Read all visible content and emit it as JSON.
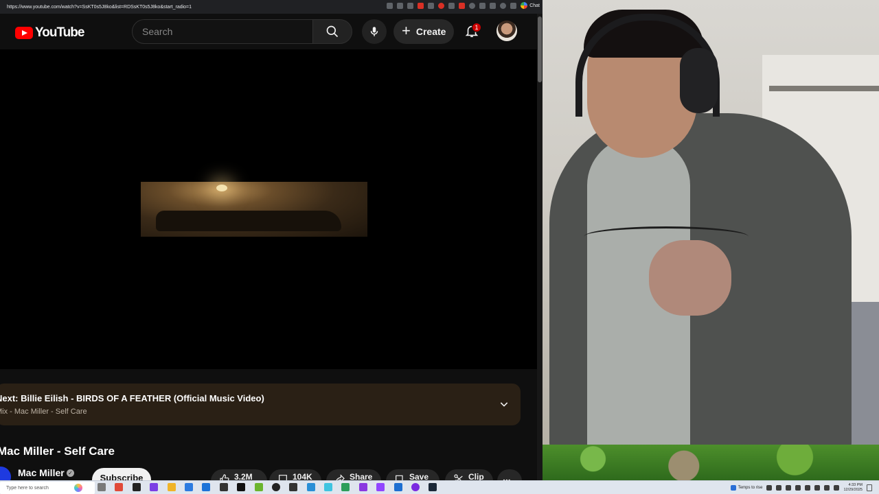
{
  "browser": {
    "url": "https://www.youtube.com/watch?v=SsKT0s5J8ko&list=RDSsKT0s5J8ko&start_radio=1",
    "chat_extension_label": "Chat"
  },
  "header": {
    "logo_text": "YouTube",
    "search_placeholder": "Search",
    "create_label": "Create",
    "notification_count": "1"
  },
  "up_next": {
    "title": "Next: Billie Eilish - BIRDS OF A FEATHER (Official Music Video)",
    "subtitle": "Mix - Mac Miller - Self Care"
  },
  "video": {
    "title": "Mac Miller - Self Care",
    "channel_name": "Mac Miller",
    "subscribe_label": "Subscribe",
    "likes": "3.2M",
    "comments": "104K",
    "share_label": "Share",
    "save_label": "Save",
    "clip_label": "Clip",
    "more_label": "..."
  },
  "taskbar": {
    "search_placeholder": "Type here to search",
    "weather_text": "Temps to rise",
    "time": "4:33 PM",
    "date": "12/29/2025"
  },
  "colors": {
    "youtube_red": "#ff0000",
    "page_background": "#0f0f0f",
    "up_next_background": "#2a2015",
    "notification_badge": "#cc0000"
  },
  "icons": {
    "search": "search-icon",
    "mic": "mic-icon",
    "bell": "bell-icon",
    "chevron": "chevron-down-icon",
    "like": "thumbs-up-icon",
    "comment": "comment-icon",
    "share": "share-icon",
    "save": "save-icon",
    "clip": "scissors-icon"
  }
}
